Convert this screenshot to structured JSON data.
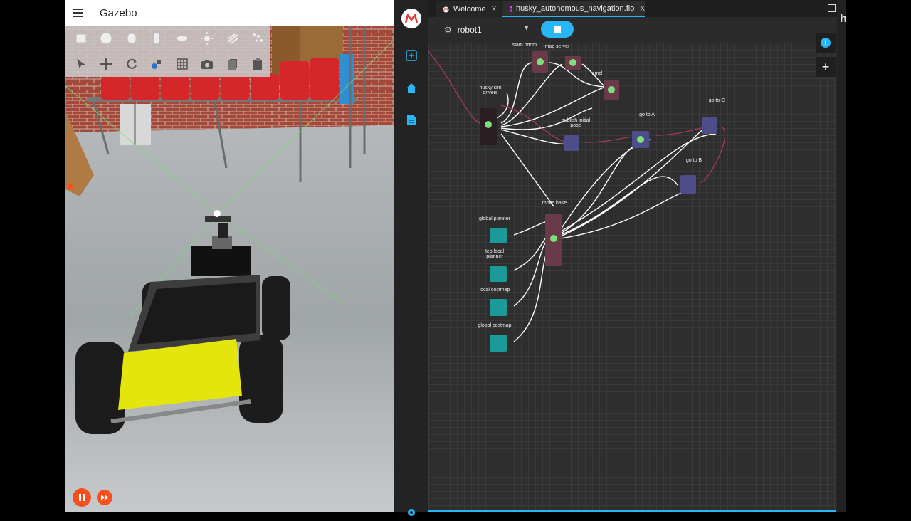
{
  "gazebo": {
    "title": "Gazebo",
    "toolbar_row1": [
      "box-icon",
      "sphere-icon",
      "cylinder-icon",
      "capsule-icon",
      "ellipsoid-icon",
      "sun-light-icon",
      "directional-light-icon",
      "spot-light-icon"
    ],
    "toolbar_row2": [
      "select-icon",
      "translate-icon",
      "rotate-icon",
      "scale-icon",
      "grid-icon",
      "screenshot-icon",
      "copy-icon",
      "paste-icon"
    ]
  },
  "flow": {
    "tabs": [
      {
        "label": "Welcome",
        "close": "X"
      },
      {
        "label": "husky_autonomous_navigation.flo",
        "close": "X"
      }
    ],
    "robot": "robot1",
    "nodes": {
      "husky_sim_drivers": "husky sim drivers",
      "slam_odom": "slam odom",
      "map_server": "map server",
      "amcl": "amcl",
      "publish_initial_pose": "publish initial pose",
      "go_to_a": "go to A",
      "go_to_b": "go to B",
      "go_to_c": "go to C",
      "move_base": "move base",
      "global_planner": "global planner",
      "teb_local_planner": "teb local planner",
      "local_costmap": "local costmap",
      "global_costmap": "global costmap"
    },
    "fab_info": "i",
    "fab_plus": "+"
  },
  "far_right": {
    "letter": "h"
  },
  "colors": {
    "accent": "#29b6f6",
    "gazebo_button": "#f4511e",
    "node_active": "#7be07b"
  }
}
